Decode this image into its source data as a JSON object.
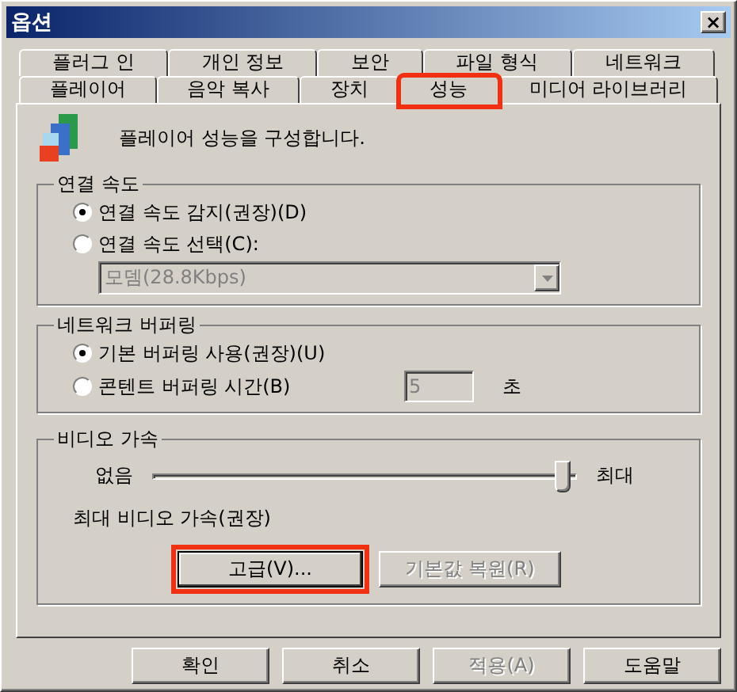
{
  "window": {
    "title": "옵션",
    "close": "×"
  },
  "tab_rows": [
    [
      {
        "label": "플러그 인",
        "selected": false,
        "highlighted": false
      },
      {
        "label": "개인 정보",
        "selected": false,
        "highlighted": false
      },
      {
        "label": "보안",
        "selected": false,
        "highlighted": false
      },
      {
        "label": "파일 형식",
        "selected": false,
        "highlighted": false
      },
      {
        "label": "네트워크",
        "selected": false,
        "highlighted": false
      }
    ],
    [
      {
        "label": "플레이어",
        "selected": false,
        "highlighted": false
      },
      {
        "label": "음악 복사",
        "selected": false,
        "highlighted": false
      },
      {
        "label": "장치",
        "selected": false,
        "highlighted": false
      },
      {
        "label": "성능",
        "selected": true,
        "highlighted": true
      },
      {
        "label": "미디어 라이브러리",
        "selected": false,
        "highlighted": false
      }
    ]
  ],
  "intro": "플레이어 성능을 구성합니다.",
  "connection_speed": {
    "title": "연결 속도",
    "options": [
      {
        "label": "연결 속도 감지(권장)(D)",
        "selected": true
      },
      {
        "label": "연결 속도 선택(C):",
        "selected": false
      }
    ],
    "dropdown": {
      "value": "모뎀(28.8Kbps)",
      "disabled": true
    }
  },
  "network_buffering": {
    "title": "네트워크 버퍼링",
    "options": [
      {
        "label": "기본 버퍼링 사용(권장)(U)",
        "selected": true
      },
      {
        "label": "콘텐트 버퍼링 시간(B)",
        "selected": false
      }
    ],
    "seconds": {
      "value": "5",
      "disabled": true
    },
    "unit": "초"
  },
  "video_acceleration": {
    "title": "비디오 가속",
    "min_label": "없음",
    "max_label": "최대",
    "level": 0.97,
    "status": "최대 비디오 가속(권장)",
    "buttons": [
      {
        "label": "고급(V)...",
        "disabled": false,
        "highlighted": true,
        "focused": true
      },
      {
        "label": "기본값 복원(R)",
        "disabled": true,
        "highlighted": false,
        "focused": false
      }
    ]
  },
  "buttons": [
    {
      "label": "확인",
      "disabled": false
    },
    {
      "label": "취소",
      "disabled": false
    },
    {
      "label": "적용(A)",
      "disabled": true
    },
    {
      "label": "도움말",
      "disabled": false
    }
  ]
}
